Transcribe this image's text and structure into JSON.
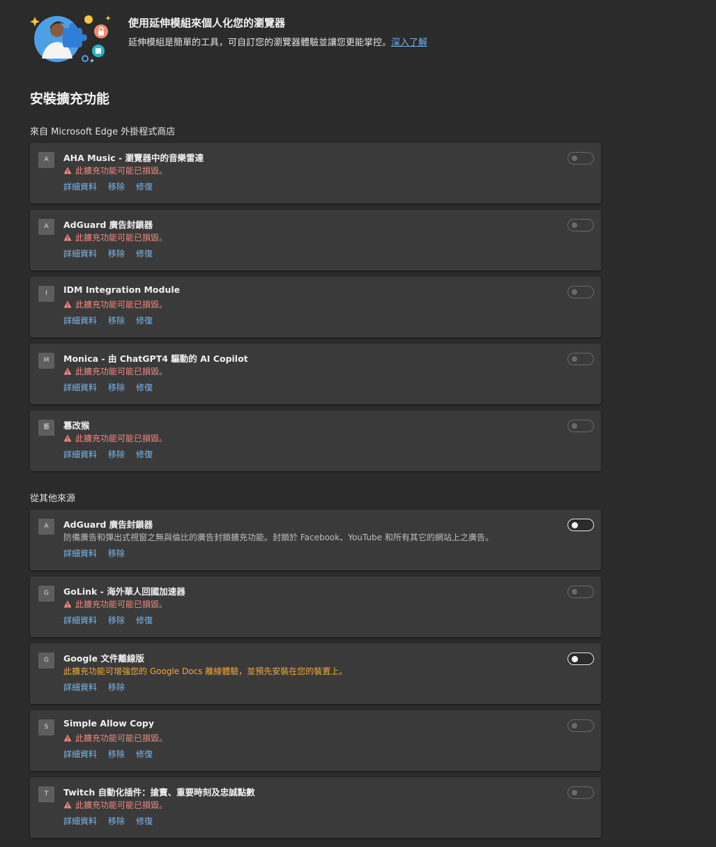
{
  "banner": {
    "title": "使用延伸模組來個人化您的瀏覽器",
    "description": "延伸模組是簡單的工具，可自訂您的瀏覽器體驗並讓您更能掌控。",
    "link": "深入了解"
  },
  "page_title": "安裝擴充功能",
  "sections": [
    {
      "title": "來自 Microsoft Edge 外掛程式商店",
      "extensions": [
        {
          "icon": "A",
          "name": "AHA Music - 瀏覽器中的音樂雷達",
          "status": "此擴充功能可能已損毀。",
          "actions": [
            "詳細資料",
            "移除",
            "修復"
          ],
          "enabled": false
        },
        {
          "icon": "A",
          "name": "AdGuard 廣告封鎖器",
          "status": "此擴充功能可能已損毀。",
          "actions": [
            "詳細資料",
            "移除",
            "修復"
          ],
          "enabled": false
        },
        {
          "icon": "I",
          "name": "IDM Integration Module",
          "status": "此擴充功能可能已損毀。",
          "actions": [
            "詳細資料",
            "移除",
            "修復"
          ],
          "enabled": false
        },
        {
          "icon": "M",
          "name": "Monica - 由 ChatGPT4 驅動的 AI Copilot",
          "status": "此擴充功能可能已損毀。",
          "actions": [
            "詳細資料",
            "移除",
            "修復"
          ],
          "enabled": false
        },
        {
          "icon": "篡",
          "name": "篡改猴",
          "status": "此擴充功能可能已損毀。",
          "actions": [
            "詳細資料",
            "移除",
            "修復"
          ],
          "enabled": false
        }
      ]
    },
    {
      "title": "從其他來源",
      "extensions": [
        {
          "icon": "A",
          "name": "AdGuard 廣告封鎖器",
          "description": "防備廣告和彈出式視窗之無與倫比的廣告封鎖擴充功能。封鎖於 Facebook、YouTube 和所有其它的網站上之廣告。",
          "actions": [
            "詳細資料",
            "移除"
          ],
          "enabled": true
        },
        {
          "icon": "G",
          "name": "GoLink - 海外華人回國加速器",
          "status": "此擴充功能可能已損毀。",
          "actions": [
            "詳細資料",
            "移除",
            "修復"
          ],
          "enabled": false
        },
        {
          "icon": "G",
          "name": "Google 文件離線版",
          "description": "此擴充功能可增強您的 Google Docs 離線體驗，並預先安裝在您的裝置上。",
          "description_color": "orange",
          "actions": [
            "詳細資料",
            "移除"
          ],
          "enabled": true
        },
        {
          "icon": "S",
          "name": "Simple Allow Copy",
          "status": "此擴充功能可能已損毀。",
          "actions": [
            "詳細資料",
            "移除",
            "修復"
          ],
          "enabled": false
        },
        {
          "icon": "T",
          "name": "Twitch 自動化插件：搶寶、重要時刻及忠誠點數",
          "status": "此擴充功能可能已損毀。",
          "actions": [
            "詳細資料",
            "移除",
            "修復"
          ],
          "enabled": false
        }
      ]
    }
  ],
  "colors": {
    "background": "#2b2b2b",
    "card": "#3a3a3a",
    "link": "#7ab8ee",
    "warning": "#f08a80",
    "notice": "#f3a93a"
  }
}
